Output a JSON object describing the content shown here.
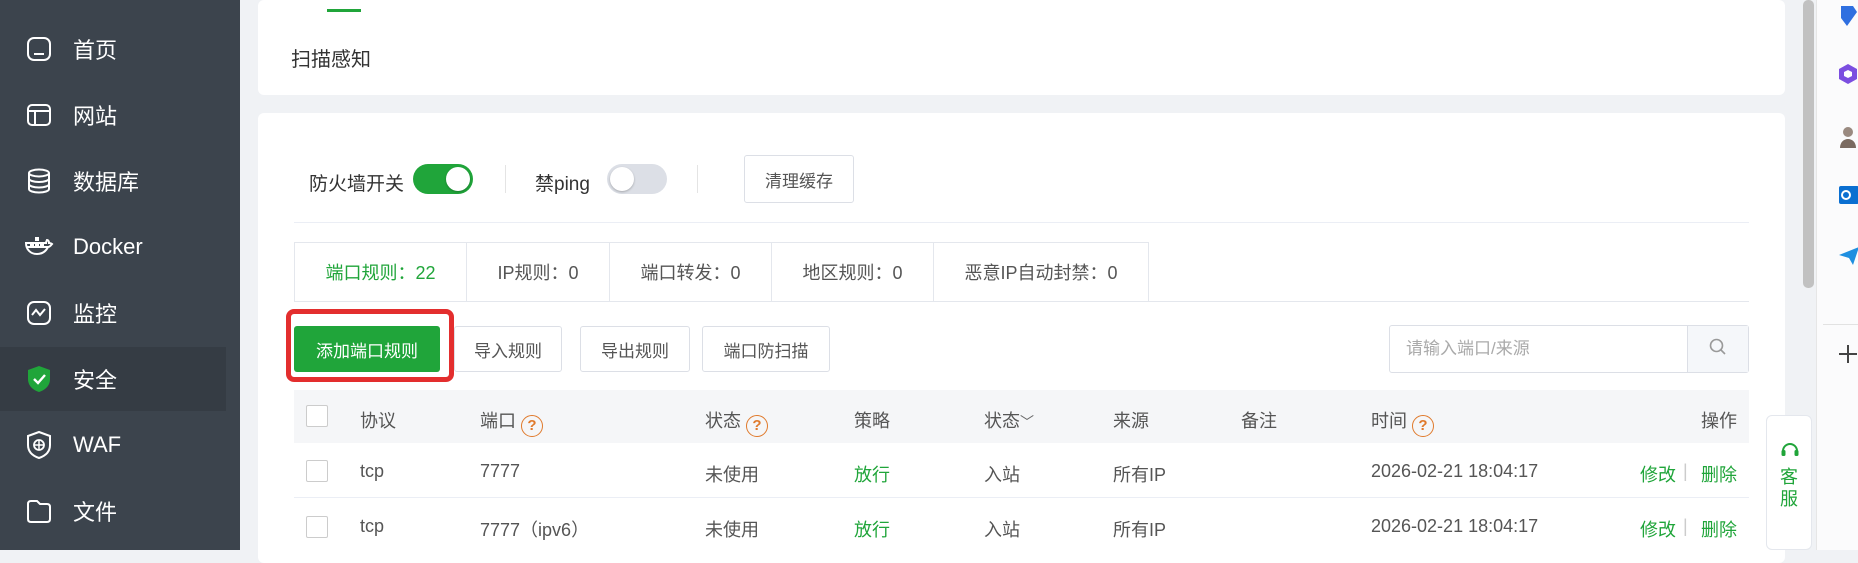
{
  "sidebar": {
    "items": [
      {
        "label": "首页",
        "icon": "home-icon"
      },
      {
        "label": "网站",
        "icon": "website-icon"
      },
      {
        "label": "数据库",
        "icon": "database-icon"
      },
      {
        "label": "Docker",
        "icon": "docker-icon"
      },
      {
        "label": "监控",
        "icon": "monitor-icon"
      },
      {
        "label": "安全",
        "icon": "shield-icon",
        "active": true
      },
      {
        "label": "WAF",
        "icon": "waf-icon"
      },
      {
        "label": "文件",
        "icon": "folder-icon"
      }
    ]
  },
  "top_card": {
    "title": "扫描感知"
  },
  "firewall": {
    "switch_label": "防火墙开关",
    "switch_on": true,
    "ping_label": "禁ping",
    "ping_on": false,
    "clear_cache_label": "清理缓存"
  },
  "tabs": [
    {
      "label": "端口规则：22",
      "active": true
    },
    {
      "label": "IP规则：0"
    },
    {
      "label": "端口转发：0"
    },
    {
      "label": "地区规则：0"
    },
    {
      "label": "恶意IP自动封禁：0"
    }
  ],
  "actions": {
    "add": "添加端口规则",
    "import": "导入规则",
    "export": "导出规则",
    "scan_protect": "端口防扫描"
  },
  "search": {
    "placeholder": "请输入端口/来源"
  },
  "table": {
    "headers": {
      "protocol": "协议",
      "port": "端口",
      "status": "状态",
      "policy": "策略",
      "direction": "状态",
      "source": "来源",
      "remark": "备注",
      "time": "时间",
      "ops": "操作"
    },
    "help_glyph": "?",
    "sort_glyph": "﹀",
    "rows": [
      {
        "protocol": "tcp",
        "port": "7777",
        "status": "未使用",
        "policy": "放行",
        "direction": "入站",
        "source": "所有IP",
        "remark": "",
        "time": "2026-02-21 18:04:17",
        "edit": "修改",
        "delete": "删除"
      },
      {
        "protocol": "tcp",
        "port": "7777（ipv6）",
        "status": "未使用",
        "policy": "放行",
        "direction": "入站",
        "source": "所有IP",
        "remark": "",
        "time": "2026-02-21 18:04:17",
        "edit": "修改",
        "delete": "删除"
      }
    ],
    "separator": "|"
  },
  "service": {
    "label": "客服"
  },
  "colors": {
    "accent": "#20a53a",
    "sidebar": "#3c444d",
    "highlight": "#e32e2e",
    "help": "#e07a2c"
  }
}
